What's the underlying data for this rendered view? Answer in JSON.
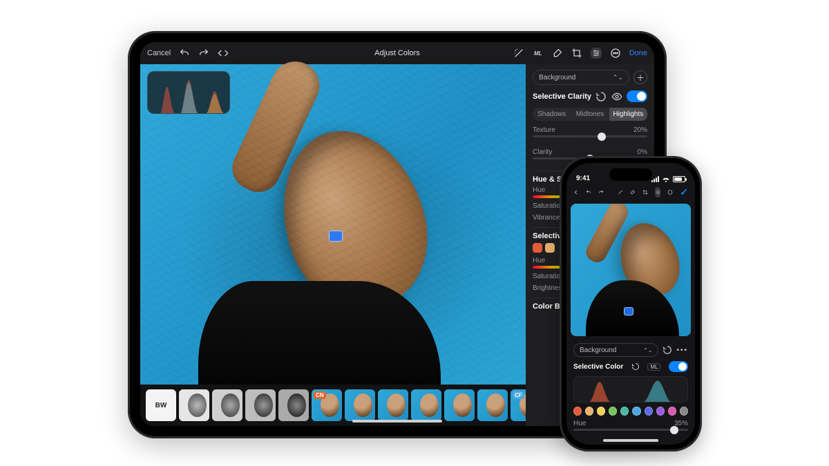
{
  "ipad": {
    "topbar": {
      "cancel": "Cancel",
      "title": "Adjust Colors",
      "done": "Done"
    },
    "filters": {
      "bw_label": "BW",
      "cn_badge": "CN",
      "cf_badge": "CF"
    },
    "inspector": {
      "layer_selector": "Background",
      "section_clarity": "Selective Clarity",
      "tabs": {
        "shadows": "Shadows",
        "midtones": "Midtones",
        "highlights": "Highlights"
      },
      "texture": {
        "label": "Texture",
        "value": "20%",
        "pos": 60
      },
      "clarity": {
        "label": "Clarity",
        "value": "0%",
        "pos": 50
      },
      "section_hs": "Hue & Saturation",
      "hue": "Hue",
      "saturation_lbl": "Saturation",
      "vibrance_lbl": "Vibrance",
      "section_sel": "Selective Color",
      "swatches": [
        "#e45a3a",
        "#e8b36b"
      ],
      "hue2": "Hue",
      "saturation2": "Saturation",
      "brightness": "Brightness",
      "section_cb": "Color Balance"
    }
  },
  "iphone": {
    "status_time": "9:41",
    "panel": {
      "layer_selector": "Background",
      "section": "Selective Color",
      "ml": "ML",
      "swatches": [
        "#e45a3a",
        "#e8b36b",
        "#ecd25a",
        "#7ac35a",
        "#4ab8a8",
        "#4aa7e0",
        "#5b6be0",
        "#9b5be0",
        "#d85bb3",
        "#888"
      ],
      "hue": {
        "label": "Hue",
        "value": "35%",
        "pos": 88
      }
    }
  }
}
